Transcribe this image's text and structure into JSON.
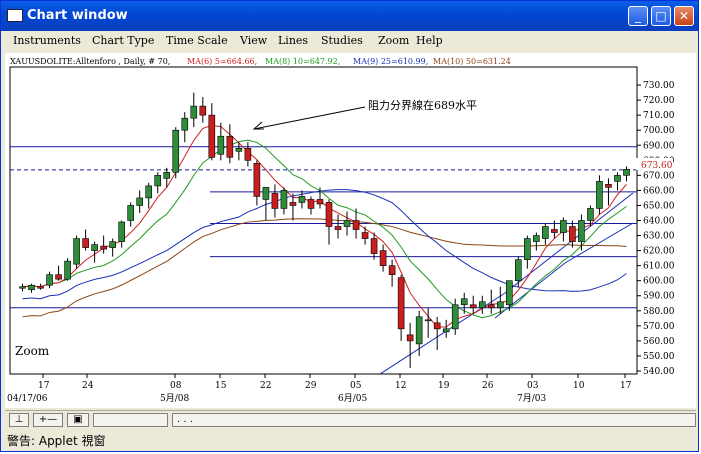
{
  "window": {
    "title": "Chart window",
    "status": "警告: Applet 視窗"
  },
  "menu": [
    "Instruments",
    "Chart Type",
    "Time Scale",
    "View",
    "Lines",
    "Studies",
    "Zoom",
    "Help"
  ],
  "legend": {
    "symbol": "XAUUSDOLITE:Alltenforo , Daily, # 70,",
    "ma1": "MA(6) 5=664.66,",
    "ma2": "MA(8) 10=647.92,",
    "ma3": "MA(9) 25=610.99,",
    "ma4": "MA(10) 50=631.24"
  },
  "annotation": "阻力分界線在689水平",
  "zoom_label": "Zoom",
  "price_badge": "673.60",
  "x_labels": [
    "17",
    "24",
    "08",
    "15",
    "22",
    "29",
    "05",
    "12",
    "19",
    "26",
    "03",
    "10",
    "17"
  ],
  "x_sublabels": [
    "04/17/06",
    "5月/08",
    "6月/05",
    "7月/03"
  ],
  "bottom_toolbar": {
    "dots": ". . ."
  },
  "colors": {
    "up": "#2f8c3a",
    "down": "#c81e1e",
    "ma6": "#d02020",
    "ma10": "#1f9a1f",
    "ma25": "#1830b8",
    "ma50": "#8b4513",
    "hline": "#1a1a9e",
    "titlebar": "#0348d4"
  },
  "chart_data": {
    "type": "candlestick",
    "y_ticks": [
      740,
      730,
      720,
      710,
      700,
      690,
      680,
      670,
      660,
      650,
      640,
      630,
      620,
      610,
      600,
      590,
      580,
      570,
      560,
      550,
      540,
      530
    ],
    "y_tick_labels": [
      "730.00",
      "720.00",
      "710.00",
      "700.00",
      "690.00",
      "680.00",
      "670.00",
      "660.00",
      "650.00",
      "640.00",
      "630.00",
      "620.00",
      "610.00",
      "600.00",
      "590.00",
      "580.00",
      "570.00",
      "560.00",
      "550.00",
      "540.00"
    ],
    "ylim": [
      538,
      742
    ],
    "candles": [
      [
        595,
        598,
        593,
        596
      ],
      [
        594,
        598,
        592,
        597
      ],
      [
        596,
        598,
        594,
        595
      ],
      [
        597,
        606,
        595,
        604
      ],
      [
        604,
        610,
        600,
        601
      ],
      [
        601,
        615,
        600,
        613
      ],
      [
        611,
        630,
        608,
        628
      ],
      [
        628,
        634,
        620,
        622
      ],
      [
        620,
        626,
        612,
        624
      ],
      [
        623,
        630,
        618,
        621
      ],
      [
        622,
        628,
        616,
        626
      ],
      [
        626,
        640,
        622,
        639
      ],
      [
        640,
        652,
        636,
        650
      ],
      [
        650,
        660,
        645,
        655
      ],
      [
        655,
        665,
        648,
        663
      ],
      [
        663,
        672,
        658,
        670
      ],
      [
        668,
        675,
        662,
        672
      ],
      [
        672,
        702,
        668,
        700
      ],
      [
        700,
        712,
        692,
        708
      ],
      [
        708,
        725,
        702,
        716
      ],
      [
        716,
        722,
        705,
        710
      ],
      [
        710,
        718,
        680,
        682
      ],
      [
        684,
        705,
        680,
        696
      ],
      [
        696,
        704,
        678,
        682
      ],
      [
        686,
        692,
        680,
        688
      ],
      [
        688,
        692,
        676,
        680
      ],
      [
        678,
        680,
        650,
        656
      ],
      [
        654,
        660,
        640,
        662
      ],
      [
        658,
        664,
        642,
        648
      ],
      [
        648,
        662,
        644,
        660
      ],
      [
        652,
        658,
        640,
        650
      ],
      [
        652,
        660,
        648,
        656
      ],
      [
        654,
        656,
        644,
        648
      ],
      [
        654,
        662,
        648,
        651
      ],
      [
        652,
        654,
        624,
        636
      ],
      [
        636,
        644,
        628,
        634
      ],
      [
        636,
        646,
        630,
        640
      ],
      [
        640,
        648,
        628,
        634
      ],
      [
        632,
        636,
        624,
        628
      ],
      [
        628,
        632,
        614,
        618
      ],
      [
        620,
        624,
        606,
        610
      ],
      [
        610,
        614,
        596,
        604
      ],
      [
        602,
        604,
        560,
        568
      ],
      [
        564,
        572,
        542,
        560
      ],
      [
        558,
        580,
        550,
        576
      ],
      [
        574,
        582,
        562,
        574
      ],
      [
        572,
        576,
        554,
        568
      ],
      [
        566,
        574,
        562,
        568
      ],
      [
        568,
        588,
        564,
        584
      ],
      [
        584,
        592,
        578,
        588
      ],
      [
        584,
        590,
        578,
        582
      ],
      [
        582,
        590,
        578,
        586
      ],
      [
        584,
        594,
        578,
        582
      ],
      [
        582,
        596,
        578,
        586
      ],
      [
        584,
        600,
        580,
        600
      ],
      [
        600,
        616,
        596,
        614
      ],
      [
        614,
        630,
        608,
        628
      ],
      [
        626,
        632,
        620,
        630
      ],
      [
        628,
        638,
        624,
        636
      ],
      [
        634,
        640,
        628,
        632
      ],
      [
        632,
        642,
        626,
        640
      ],
      [
        636,
        640,
        622,
        626
      ],
      [
        626,
        644,
        620,
        640
      ],
      [
        640,
        650,
        636,
        648
      ],
      [
        648,
        670,
        644,
        666
      ],
      [
        664,
        668,
        650,
        662
      ],
      [
        666,
        672,
        660,
        670
      ],
      [
        670,
        676,
        666,
        674
      ]
    ],
    "h_lines": [
      689,
      659,
      638,
      616,
      582
    ],
    "dashed_line": 673.6,
    "x_axis_title": ""
  }
}
